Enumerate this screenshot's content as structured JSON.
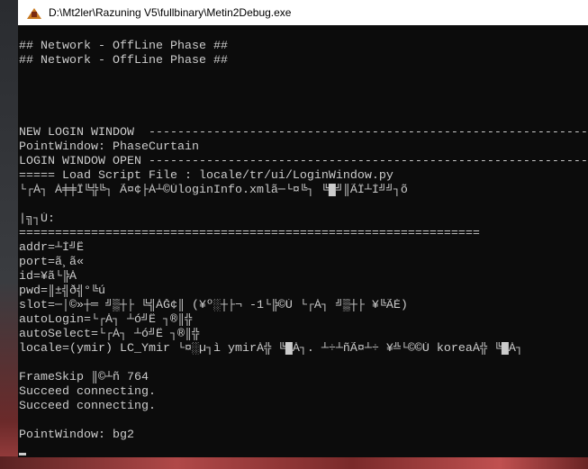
{
  "window": {
    "title": "D:\\Mt2ler\\Razuning V5\\fullbinary\\Metin2Debug.exe",
    "icon": "metin2-app-icon"
  },
  "console": {
    "lines": [
      "## Network - OffLine Phase ##",
      "## Network - OffLine Phase ##",
      "",
      "",
      "",
      "",
      "NEW LOGIN WINDOW  ------------------------------------------------------------------------------------",
      "PointWindow: PhaseCurtain",
      "LOGIN WINDOW OPEN ------------------------------------------------------------------------------------",
      "===== Load Script File : locale/tr/ui/LoginWindow.py",
      "└┌Á┐ À╪╪Î╚╬╚┐ Ã¤¢├À┴©ÚloginInfo.xmlã─└¤╚┐ ╚█╝║ÃÏ┴Í╝╝┐õ",
      "",
      "|╗┐Ù:",
      "================================================================",
      "addr=┴Í╝Ê",
      "port=ã¸ã«",
      "id=¥ã└╠Á­",
      "pwd=║±╣ð╣°╚ú",
      "slot=─│©»┼═ ╝▒┼├ ╚╣ÁĞ¢║ (¥º░┼├¬ -1└╠©Ú └┌Á┐ ╝▒┼├ ¥╚ÃÈ)",
      "autoLogin=└┌Á┐ ┴ó╝Ë ┐®║╬",
      "autoSelect=└┌Á┐ ┴ó╝Ë ┐®║╬",
      "locale=(ymir) LC_Ymir └¤░µ┐ì ymirÀ╬ ╚█Á┐. ┴÷┴ñÃ¤┴÷ ¥╩└©©Ú koreaÀ╬ ╚█Á┐",
      "",
      "FrameSkip ║©┴ñ 764",
      "Succeed connecting.",
      "Succeed connecting.",
      "",
      "PointWindow: bg2"
    ]
  }
}
